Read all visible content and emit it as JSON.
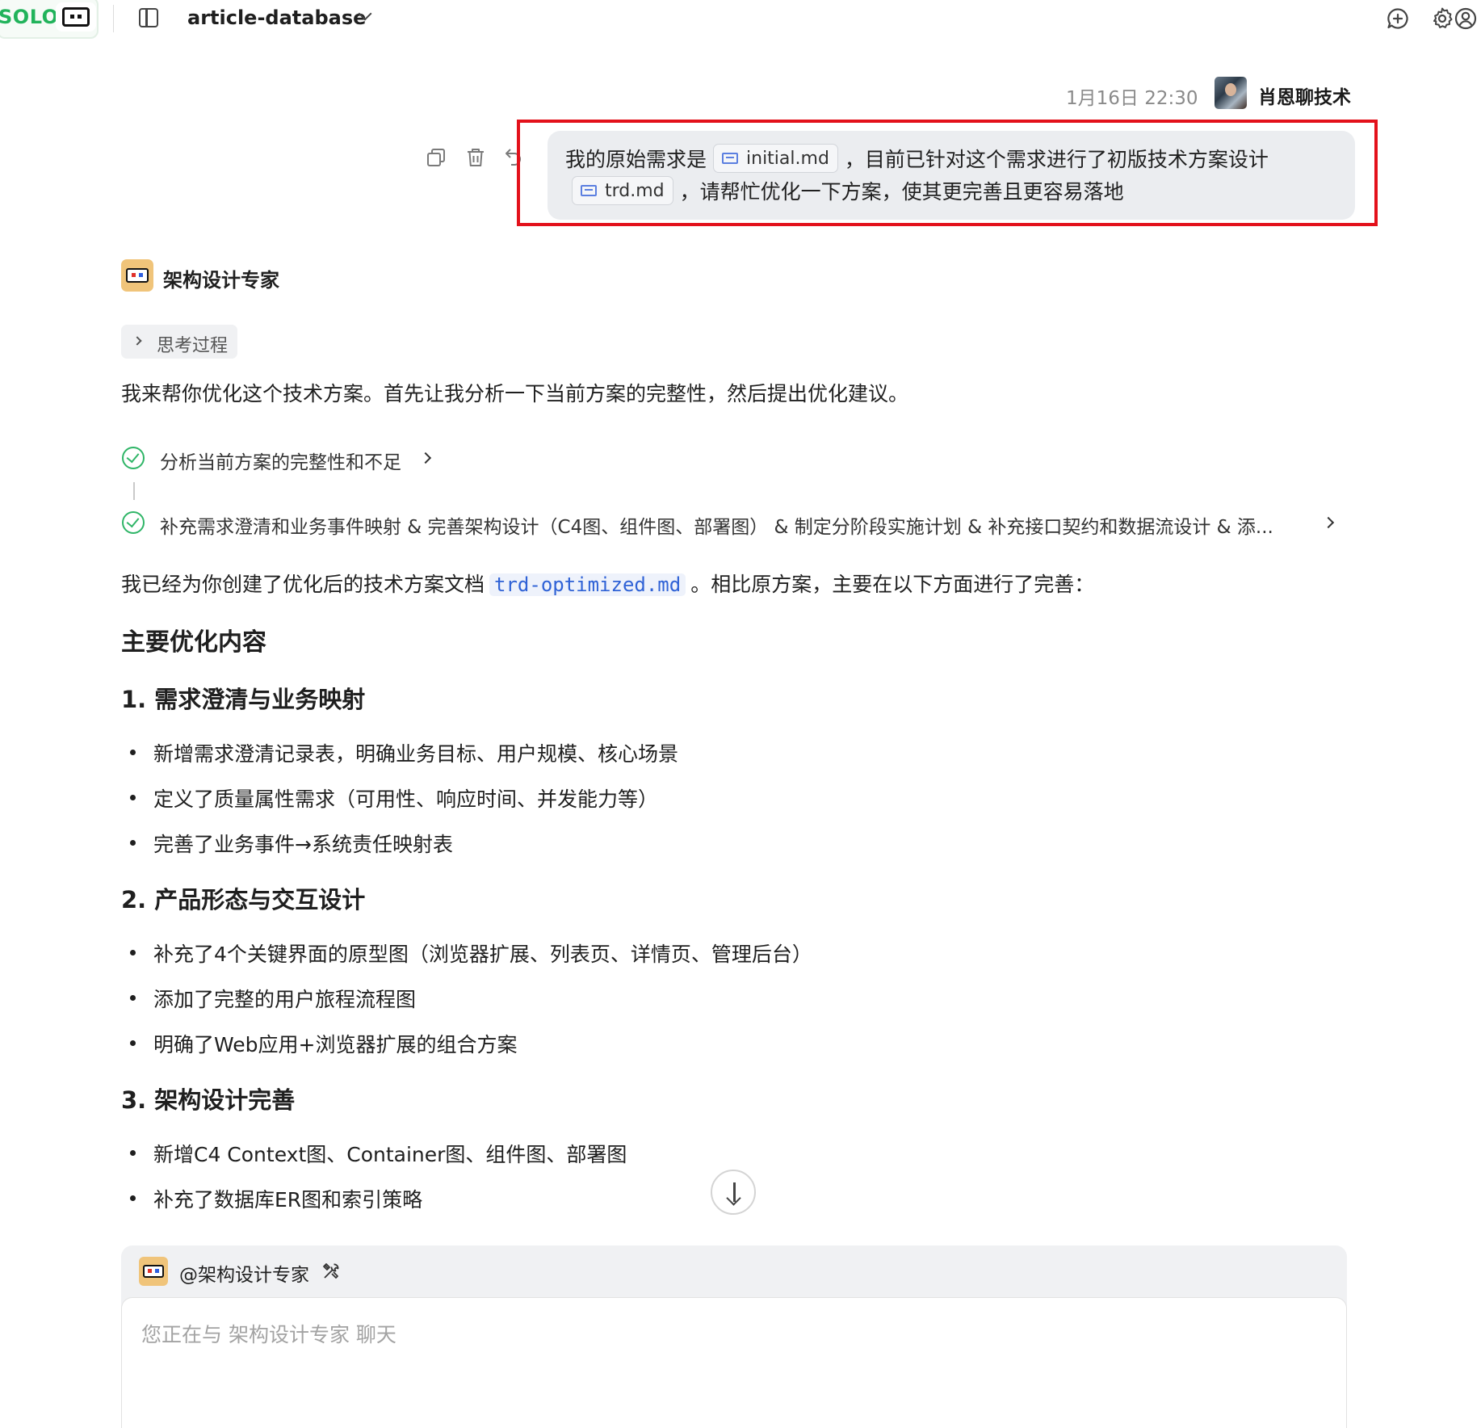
{
  "topbar": {
    "mode_label": "SOLO",
    "project_name": "article-database"
  },
  "user_message": {
    "time": "1月16日 22:30",
    "username": "肖恩聊技术",
    "line1_prefix": "我的原始需求是",
    "file1": "initial.md",
    "line1_suffix": "，目前已针对这个需求进行了初版技术方案设计",
    "file2": "trd.md",
    "line2_suffix": "，请帮忙优化一下方案，使其更完善且更容易落地"
  },
  "assistant": {
    "name": "架构设计专家",
    "thinking_label": "思考过程",
    "intro": "我来帮你优化这个技术方案。首先让我分析一下当前方案的完整性，然后提出优化建议。",
    "steps": [
      {
        "label": "分析当前方案的完整性和不足"
      },
      {
        "label": "补充需求澄清和业务事件映射 & 完善架构设计（C4图、组件图、部署图） & 制定分阶段实施计划 & 补充接口契约和数据流设计 & 添..."
      }
    ],
    "created_prefix": "我已经为你创建了优化后的技术方案文档",
    "created_file": "trd-optimized.md",
    "created_suffix": "。相比原方案，主要在以下方面进行了完善：",
    "heading": "主要优化内容",
    "sections": [
      {
        "title": "1. 需求澄清与业务映射",
        "items": [
          "新增需求澄清记录表，明确业务目标、用户规模、核心场景",
          "定义了质量属性需求（可用性、响应时间、并发能力等）",
          "完善了业务事件→系统责任映射表"
        ]
      },
      {
        "title": "2. 产品形态与交互设计",
        "items": [
          "补充了4个关键界面的原型图（浏览器扩展、列表页、详情页、管理后台）",
          "添加了完整的用户旅程流程图",
          "明确了Web应用+浏览器扩展的组合方案"
        ]
      },
      {
        "title": "3. 架构设计完善",
        "items": [
          "新增C4 Context图、Container图、组件图、部署图",
          "补充了数据库ER图和索引策略"
        ]
      }
    ]
  },
  "composer": {
    "mention": "@架构设计专家",
    "placeholder": "您正在与 架构设计专家 聊天",
    "value": ""
  },
  "colors": {
    "solo_green": "#21b35b",
    "highlight_red": "#e3111b",
    "check_green": "#2fb567",
    "code_blue": "#2f62d6"
  },
  "icons": [
    "panel-toggle-icon",
    "chevron-down-icon",
    "new-chat-icon",
    "gear-icon",
    "account-icon",
    "copy-icon",
    "trash-icon",
    "undo-icon",
    "markdown-file-icon",
    "check-circle-icon",
    "chevron-right-icon",
    "arrow-down-icon",
    "tools-icon"
  ]
}
